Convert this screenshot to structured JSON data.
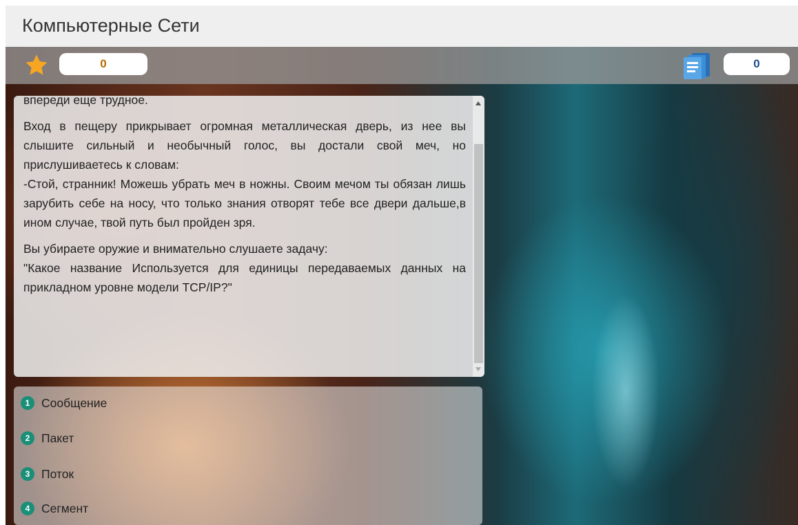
{
  "header": {
    "title": "Компьютерные Сети"
  },
  "status": {
    "score_icon": "star-icon",
    "score_value": "0",
    "cards_icon": "cards-icon",
    "cards_value": "0"
  },
  "colors": {
    "header_bg": "#efefef",
    "star": "#f6a623",
    "cards": "#3b8ed8",
    "badge": "#1a8f78",
    "score_text": "#b36a00",
    "cards_text": "#1e4d8a"
  },
  "story": {
    "partial_line": "впереди еще трудное.",
    "paragraph1": "Вход в пещеру прикрывает огромная металлическая дверь, из нее вы слышите сильный и необычный голос, вы достали свой меч, но прислушиваетесь к словам:",
    "paragraph1b": "-Стой, странник! Можешь убрать меч в ножны. Своим мечом ты обязан лишь зарубить себе на носу, что только знания отворят тебе все двери дальше,в ином случае, твой путь был пройден зря.",
    "paragraph2": "Вы убираете оружие и внимательно слушаете задачу:",
    "question": "\"Какое название Используется для единицы передаваемых данных на прикладном уровне модели TCP/IP?\""
  },
  "answers": [
    {
      "number": "1",
      "label": "Сообщение"
    },
    {
      "number": "2",
      "label": "Пакет"
    },
    {
      "number": "3",
      "label": "Поток"
    },
    {
      "number": "4",
      "label": "Сегмент"
    }
  ]
}
